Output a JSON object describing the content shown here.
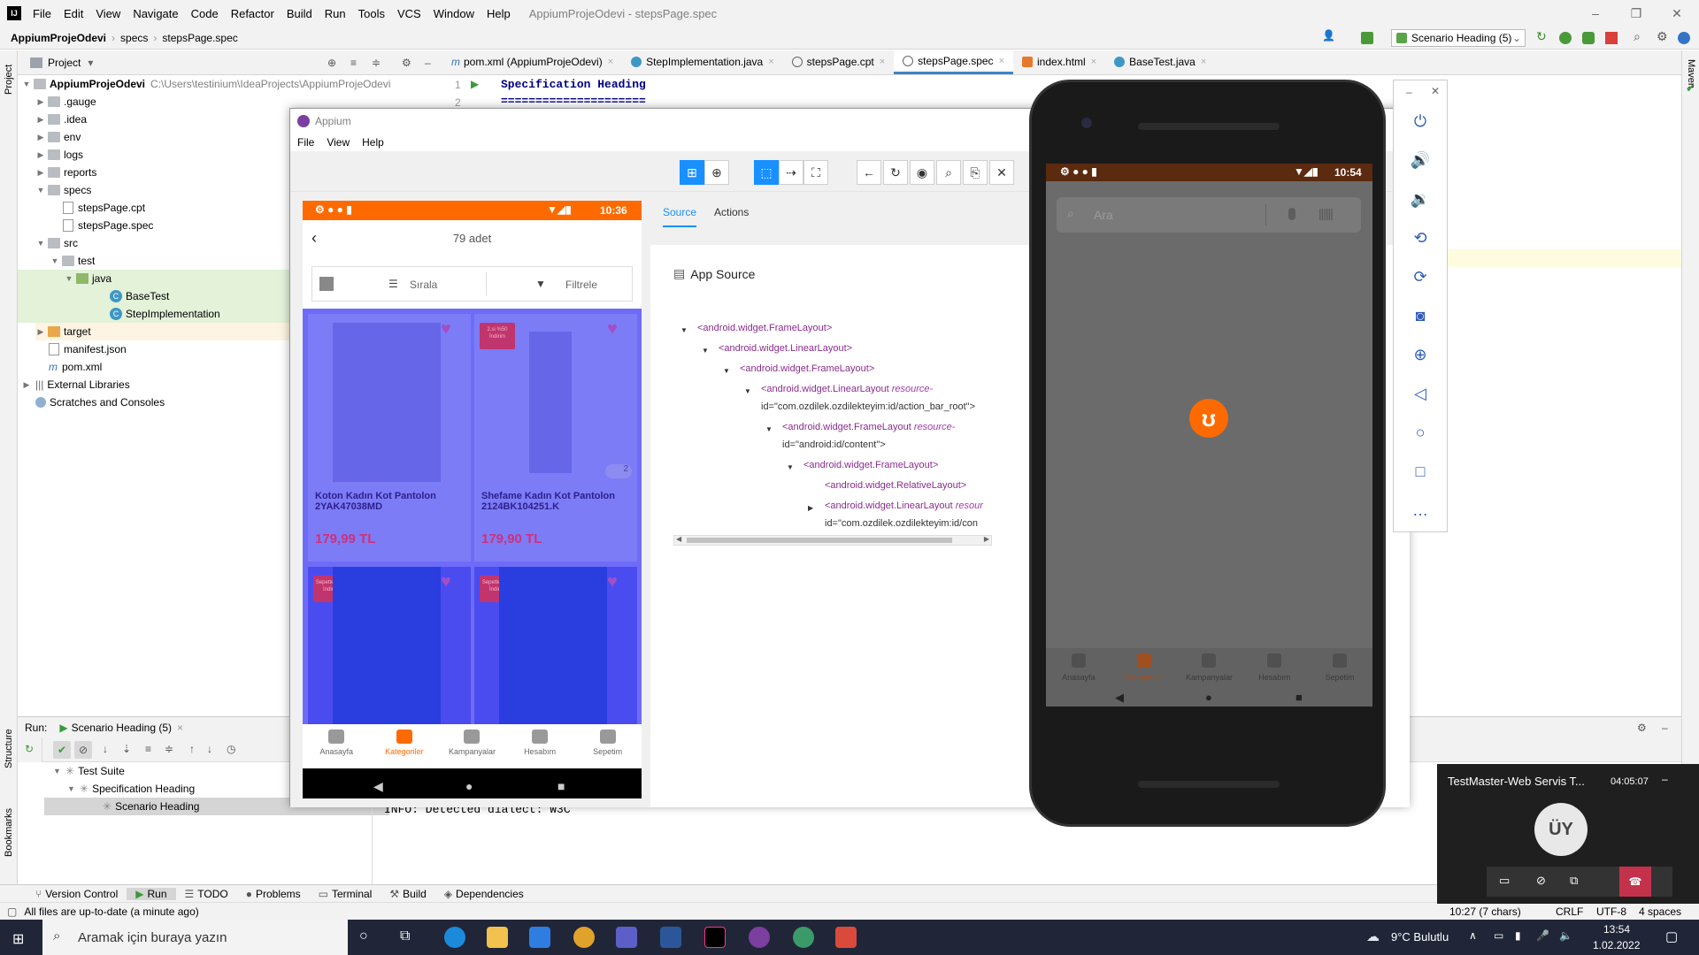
{
  "ide": {
    "menu": [
      "File",
      "Edit",
      "View",
      "Navigate",
      "Code",
      "Refactor",
      "Build",
      "Run",
      "Tools",
      "VCS",
      "Window",
      "Help"
    ],
    "window_title": "AppiumProjeOdevi - stepsPage.spec",
    "breadcrumb": [
      "AppiumProjeOdevi",
      "specs",
      "stepsPage.spec"
    ],
    "run_config": "Scenario Heading (5)",
    "project_panel_title": "Project",
    "left_strip": [
      "Project",
      "Structure",
      "Bookmarks"
    ],
    "right_strip": "Maven",
    "tree": {
      "root": "AppiumProjeOdevi",
      "root_path": "C:\\Users\\testinium\\IdeaProjects\\AppiumProjeOdevi",
      "items": [
        ".gauge",
        ".idea",
        "env",
        "logs",
        "reports",
        "specs",
        "stepsPage.cpt",
        "stepsPage.spec",
        "src",
        "test",
        "java",
        "BaseTest",
        "StepImplementation",
        "target",
        "manifest.json",
        "pom.xml",
        "External Libraries",
        "Scratches and Consoles"
      ]
    },
    "tabs": [
      "pom.xml (AppiumProjeOdevi)",
      "StepImplementation.java",
      "stepsPage.cpt",
      "stepsPage.spec",
      "index.html",
      "BaseTest.java"
    ],
    "editor": {
      "line1_no": "1",
      "line1": "Specification Heading",
      "line2_no": "2",
      "line2": "====================="
    },
    "run": {
      "label": "Run:",
      "tab": "Scenario Heading (5)",
      "tree": [
        "Test Suite",
        "Specification Heading",
        "Scenario Heading"
      ],
      "console": "INFO: Detected dialect: W3C"
    },
    "bottom_tools": [
      "Version Control",
      "Run",
      "TODO",
      "Problems",
      "Terminal",
      "Build",
      "Dependencies"
    ],
    "status_message": "All files are up-to-date (a minute ago)",
    "status_right": [
      "10:27 (7 chars)",
      "CRLF",
      "UTF-8",
      "4 spaces"
    ]
  },
  "appium": {
    "title": "Appium",
    "menu": [
      "File",
      "View",
      "Help"
    ],
    "screenshot": {
      "time": "10:36",
      "count": "79 adet",
      "sort": "Sırala",
      "filter": "Filtrele",
      "products": [
        {
          "name": "Koton Kadın Kot Pantolon 2YAK47038MD",
          "price": "179,99 TL",
          "badge": ""
        },
        {
          "name": "Shefame Kadın Kot Pantolon 2124BK104251.K",
          "price": "179,90 TL",
          "badge": "2.si %50 İndirim",
          "colors": "2"
        },
        {
          "name": "",
          "price": "",
          "badge": "Sepette %50 İndirim"
        },
        {
          "name": "",
          "price": "",
          "badge": "Sepette %50 İndirim"
        }
      ],
      "nav": [
        "Anasayfa",
        "Kategoriler",
        "Kampanyalar",
        "Hesabım",
        "Sepetim"
      ]
    },
    "tabs": [
      "Source",
      "Actions"
    ],
    "source_title": "App Source",
    "nodes": [
      {
        "tag": "<android.widget.FrameLayout>"
      },
      {
        "tag": "<android.widget.LinearLayout>"
      },
      {
        "tag": "<android.widget.FrameLayout>"
      },
      {
        "tag": "<android.widget.LinearLayout",
        "attr": "resource-",
        "val": "id=\"com.ozdilek.ozdilekteyim:id/action_bar_root\">"
      },
      {
        "tag": "<android.widget.FrameLayout",
        "attr": "resource-",
        "val": "id=\"android:id/content\">"
      },
      {
        "tag": "<android.widget.FrameLayout>"
      },
      {
        "tag": "<android.widget.RelativeLayout>"
      },
      {
        "tag": "<android.widget.LinearLayout",
        "attr": "resour",
        "val": "id=\"com.ozdilek.ozdilekteyim:id/con"
      }
    ]
  },
  "phone": {
    "time": "10:54",
    "search_placeholder": "Ara",
    "nav": [
      "Anasayfa",
      "Kategoriler",
      "Kampanyalar",
      "Hesabım",
      "Sepetim"
    ],
    "brand_color": "#ff6a00"
  },
  "meeting": {
    "title": "TestMaster-Web Servis T...",
    "timer": "04:05:07",
    "avatar": "ÜY"
  },
  "taskbar": {
    "search": "Aramak için buraya yazın",
    "weather": "9°C  Bulutlu",
    "time": "13:54",
    "date": "1.02.2022"
  }
}
